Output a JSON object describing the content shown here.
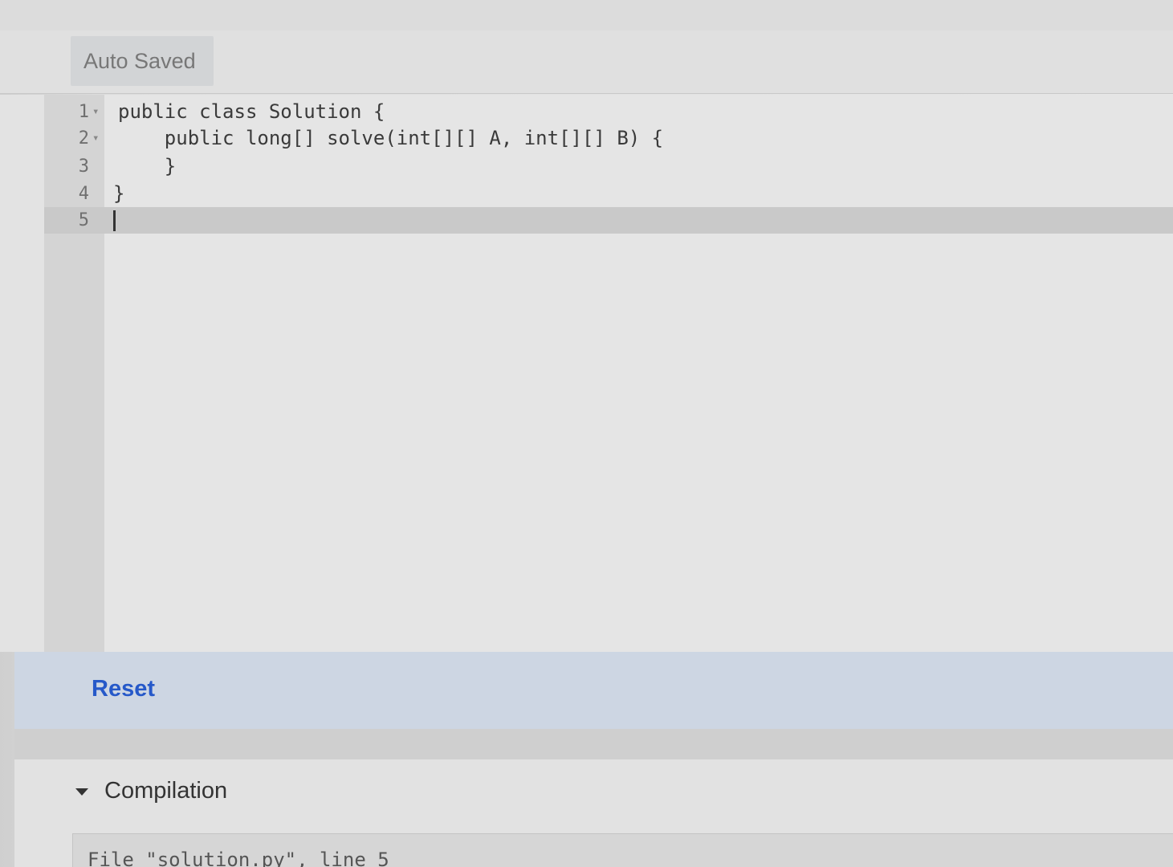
{
  "toolbar": {
    "autosave_label": "Auto Saved"
  },
  "editor": {
    "lines": [
      {
        "number": "1",
        "fold": "▾",
        "code": "public class Solution {"
      },
      {
        "number": "2",
        "fold": "▾",
        "code": "    public long[] solve(int[][] A, int[][] B) {"
      },
      {
        "number": "3",
        "fold": "",
        "code": "    }"
      },
      {
        "number": "4",
        "fold": "",
        "code": "}"
      },
      {
        "number": "5",
        "fold": "",
        "code": ""
      }
    ],
    "active_line": 5
  },
  "actions": {
    "reset_label": "Reset"
  },
  "compilation": {
    "header": "Compilation",
    "output": "File \"solution.py\", line 5"
  }
}
